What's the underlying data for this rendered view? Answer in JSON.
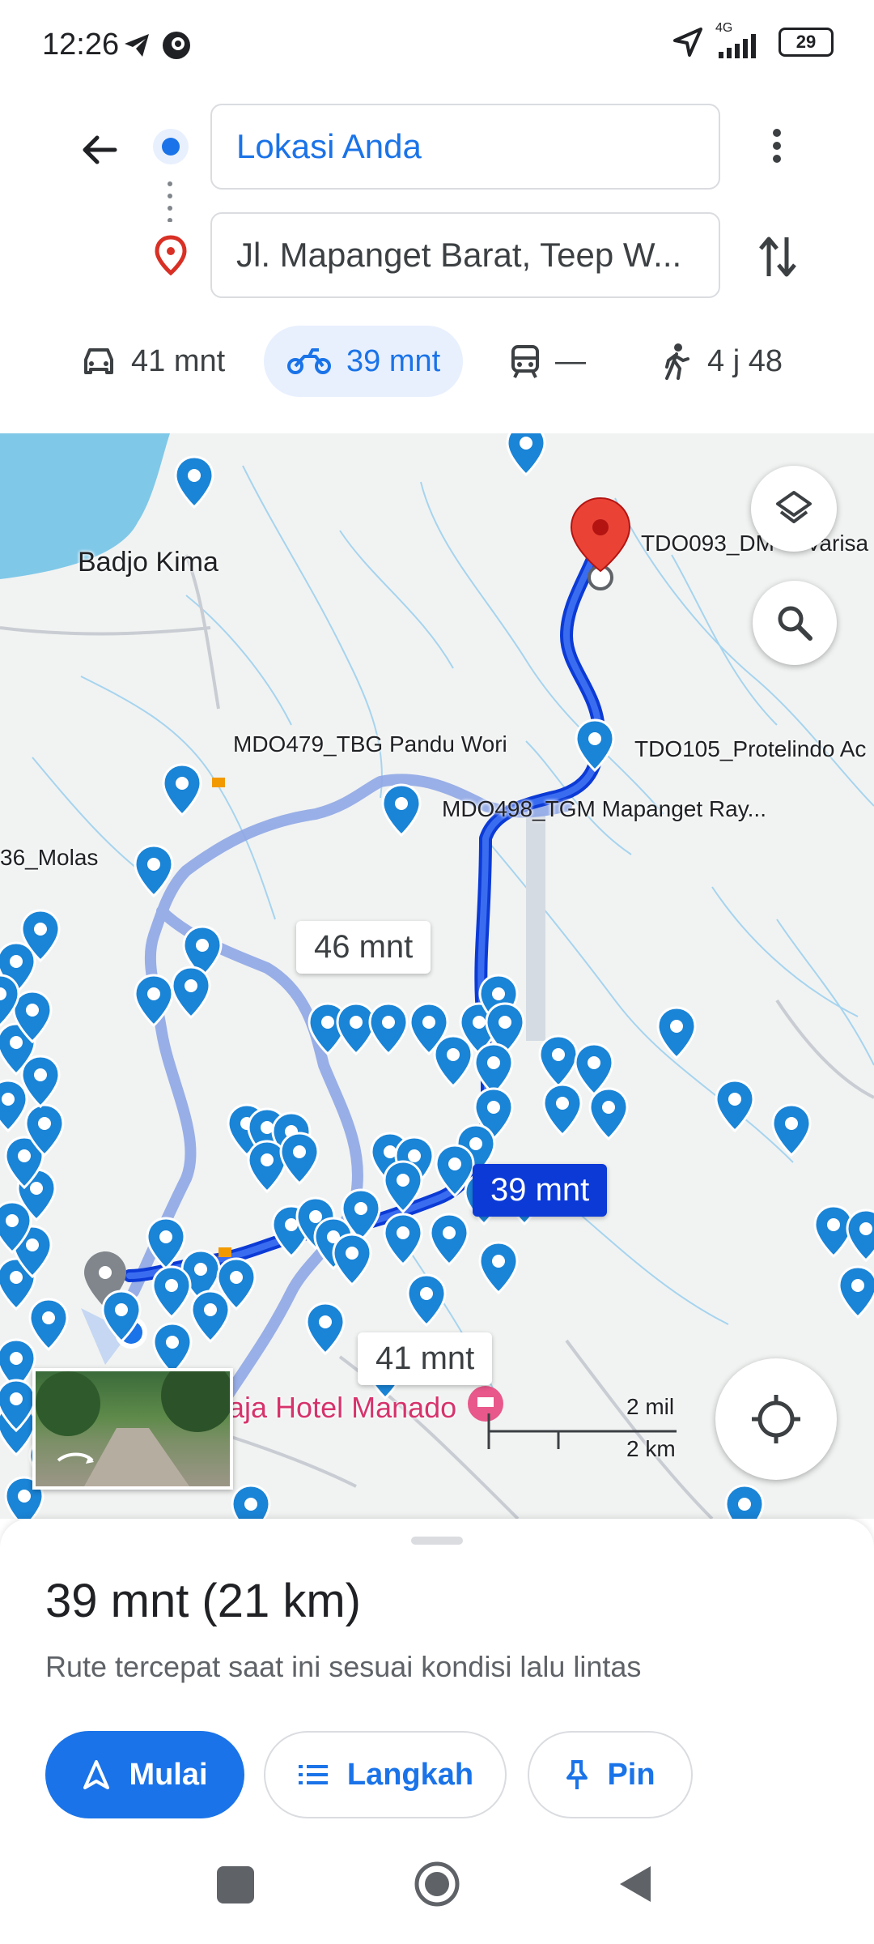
{
  "status_bar": {
    "time": "12:26",
    "network": "4G",
    "battery": "29"
  },
  "directions": {
    "origin": "Lokasi Anda",
    "destination": "Jl. Mapanget Barat, Teep W..."
  },
  "modes": [
    {
      "name": "car",
      "label": "41 mnt"
    },
    {
      "name": "motorcycle",
      "label": "39 mnt",
      "selected": true
    },
    {
      "name": "transit",
      "label": "—"
    },
    {
      "name": "walk",
      "label": "4 j 48"
    }
  ],
  "map": {
    "labels": {
      "badjo": "Badjo Kima",
      "tdo093": "TDO093_DM     Varisa",
      "mdo479": "MDO479_TBG Pandu Wori",
      "tdo105": "TDO105_Protelindo Ac",
      "mdo498": "MDO498_TGM Mapanget Ray...",
      "molas": "36_Molas",
      "hotel": "aja Hotel Manado"
    },
    "route_times": {
      "alt_a": "46 mnt",
      "main": "39 mnt",
      "alt_b": "41 mnt"
    },
    "scale": {
      "mi": "2 mil",
      "km": "2 km"
    },
    "accent": "#1a73e8",
    "route_color": "#0b3ad6"
  },
  "sheet": {
    "summary": "39 mnt (21 km)",
    "description": "Rute tercepat saat ini sesuai kondisi lalu lintas",
    "buttons": {
      "start": "Mulai",
      "steps": "Langkah",
      "pin": "Pin"
    }
  }
}
